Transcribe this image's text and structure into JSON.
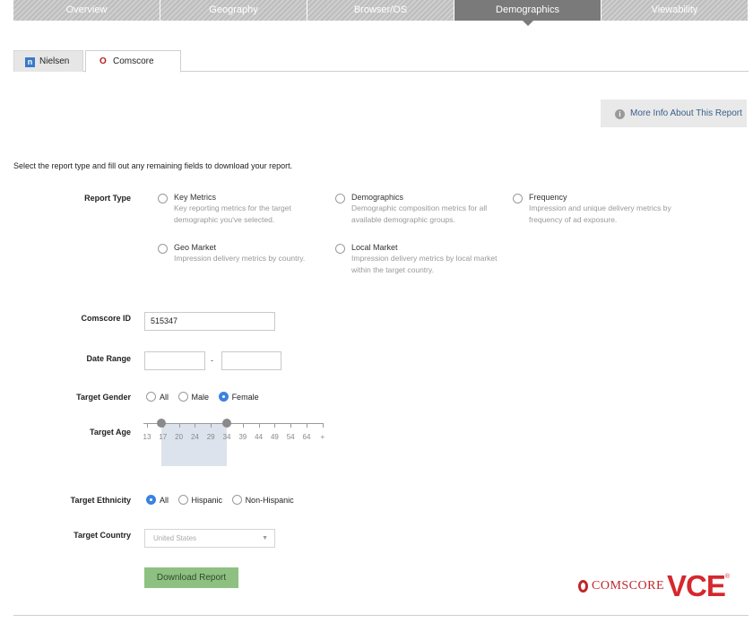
{
  "topnav": {
    "tabs": [
      {
        "label": "Overview"
      },
      {
        "label": "Geography"
      },
      {
        "label": "Browser/OS"
      },
      {
        "label": "Demographics",
        "active": true
      },
      {
        "label": "Viewability"
      }
    ]
  },
  "providers": {
    "nielsen_label": "Nielsen",
    "nielsen_icon": "n",
    "comscore_label": "Comscore",
    "comscore_icon": "O"
  },
  "more_info": {
    "label": "More Info About This Report",
    "icon": "i"
  },
  "intro_text": "Select the report type and fill out any remaining fields to download your report.",
  "report_type": {
    "label": "Report Type",
    "options": [
      {
        "title": "Key Metrics",
        "desc": "Key reporting metrics for the target demographic you've selected."
      },
      {
        "title": "Demographics",
        "desc": "Demographic composition metrics for all available demographic groups."
      },
      {
        "title": "Frequency",
        "desc": "Impression and unique delivery metrics by frequency of ad exposure."
      },
      {
        "title": "Geo Market",
        "desc": "Impression delivery metrics by country."
      },
      {
        "title": "Local Market",
        "desc": "Impression delivery metrics by local market within the target country."
      }
    ]
  },
  "comscore_id": {
    "label": "Comscore ID",
    "value": "515347"
  },
  "date_range": {
    "label": "Date Range",
    "separator": "-",
    "start": "",
    "end": ""
  },
  "target_gender": {
    "label": "Target Gender",
    "options": [
      "All",
      "Male",
      "Female"
    ],
    "selected": "Female"
  },
  "target_age": {
    "label": "Target Age",
    "ticks": [
      "13",
      "17",
      "20",
      "24",
      "29",
      "34",
      "39",
      "44",
      "49",
      "54",
      "64",
      "+"
    ],
    "range": [
      "17",
      "34"
    ]
  },
  "target_ethnicity": {
    "label": "Target Ethnicity",
    "options": [
      "All",
      "Hispanic",
      "Non-Hispanic"
    ],
    "selected": "All"
  },
  "target_country": {
    "label": "Target Country",
    "value": "United States",
    "arrow": "▼"
  },
  "download_button": {
    "label": "Download Report"
  },
  "brand": {
    "comscore_word": "COMSCORE",
    "vce": "VCE",
    "reg": "®"
  },
  "colors": {
    "accent": "#3b82e0",
    "download": "#8ec081",
    "brand_red": "#d5282e"
  }
}
